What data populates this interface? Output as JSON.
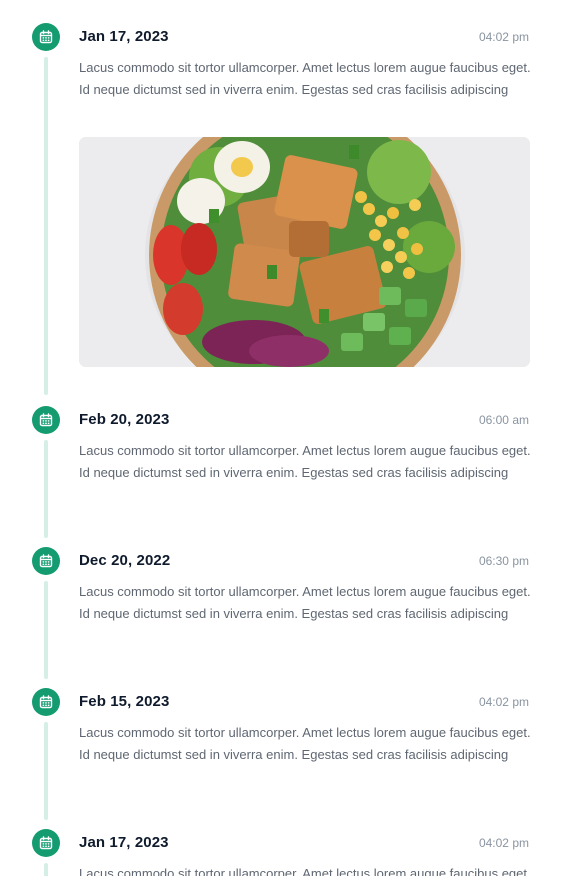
{
  "colors": {
    "accent": "#149b6f",
    "rail": "#d6efe6",
    "date_text": "#0f1b2d",
    "body_text": "#5f6772",
    "time_text": "#8a94a0"
  },
  "marker_icon": "calendar-icon",
  "entries": [
    {
      "date": "Jan 17, 2023",
      "time": "04:02 pm",
      "text": "Lacus commodo sit tortor ullamcorper. Amet lectus lorem augue faucibus eget. Id neque dictumst sed in viverra enim. Egestas sed cras facilisis adipiscing",
      "image": "salad-bowl-photo"
    },
    {
      "date": "Feb 20, 2023",
      "time": "06:00 am",
      "text": "Lacus commodo sit tortor ullamcorper. Amet lectus lorem augue faucibus eget. Id neque dictumst sed in viverra enim. Egestas sed cras facilisis adipiscing"
    },
    {
      "date": "Dec 20, 2022",
      "time": "06:30 pm",
      "text": "Lacus commodo sit tortor ullamcorper. Amet lectus lorem augue faucibus eget. Id neque dictumst sed in viverra enim. Egestas sed cras facilisis adipiscing"
    },
    {
      "date": "Feb 15, 2023",
      "time": "04:02 pm",
      "text": "Lacus commodo sit tortor ullamcorper. Amet lectus lorem augue faucibus eget. Id neque dictumst sed in viverra enim. Egestas sed cras facilisis adipiscing"
    },
    {
      "date": "Jan 17, 2023",
      "time": "04:02 pm",
      "text": "Lacus commodo sit tortor ullamcorper. Amet lectus lorem augue faucibus eget. Id neque dictumst sed in viverra enim. Egestas sed cras facilisis adipiscing"
    }
  ]
}
